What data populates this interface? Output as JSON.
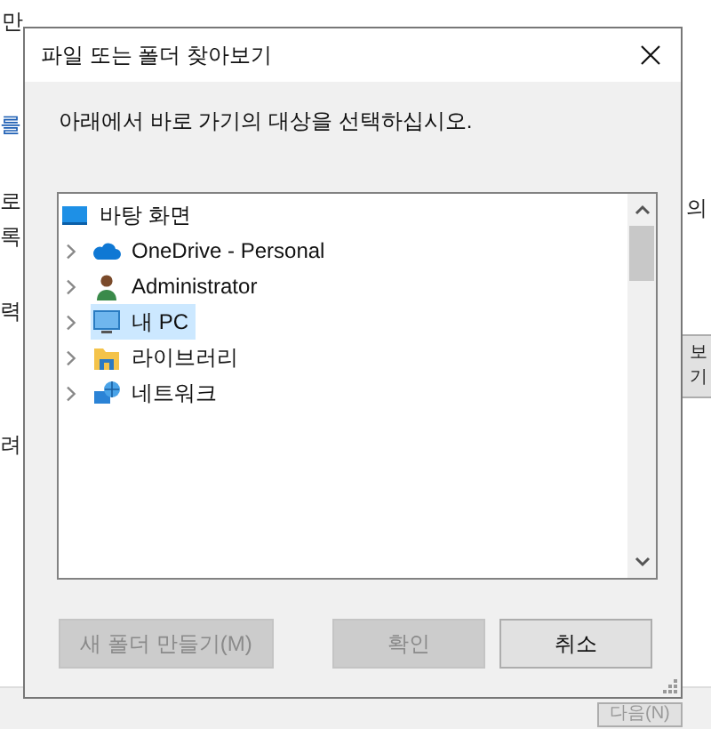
{
  "background_window": {
    "fragments": [
      {
        "text": "만",
        "kind": "text"
      },
      {
        "text": "를",
        "kind": "link"
      },
      {
        "text": "로",
        "kind": "text"
      },
      {
        "text": "록",
        "kind": "text"
      },
      {
        "text": "력",
        "kind": "text"
      },
      {
        "text": "려",
        "kind": "text"
      },
      {
        "text": "의",
        "kind": "text"
      },
      {
        "text": "보기",
        "kind": "button"
      },
      {
        "text": "다음(N)",
        "kind": "button"
      }
    ]
  },
  "dialog": {
    "title": "파일 또는 폴더 찾아보기",
    "instruction": "아래에서 바로 가기의 대상을 선택하십시오.",
    "tree": [
      {
        "label": "바탕 화면",
        "kind": "desktop",
        "selected": false,
        "children": [
          {
            "label": "OneDrive - Personal",
            "kind": "cloud",
            "selected": false,
            "expanded": false
          },
          {
            "label": "Administrator",
            "kind": "user",
            "selected": false,
            "expanded": false
          },
          {
            "label": "내 PC",
            "kind": "computer",
            "selected": true,
            "expanded": false
          },
          {
            "label": "라이브러리",
            "kind": "library",
            "selected": false,
            "expanded": false
          },
          {
            "label": "네트워크",
            "kind": "network",
            "selected": false,
            "expanded": false
          }
        ]
      }
    ],
    "buttons": [
      {
        "label": "새 폴더 만들기(M)",
        "disabled": true
      },
      {
        "label": "확인",
        "disabled": true
      },
      {
        "label": "취소",
        "disabled": false
      }
    ]
  }
}
